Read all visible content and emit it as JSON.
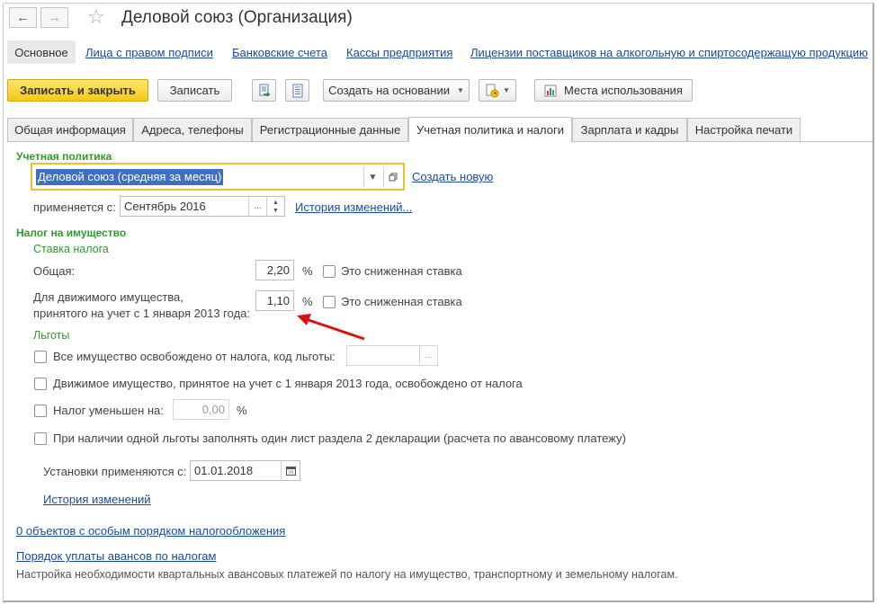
{
  "window": {
    "title": "Деловой союз (Организация)"
  },
  "nav_links": {
    "main": "Основное",
    "items": [
      "Лица с правом подписи",
      "Банковские счета",
      "Кассы предприятия",
      "Лицензии поставщиков на алкогольную и спиртосодержащую продукцию"
    ]
  },
  "toolbar": {
    "save_close": "Записать и закрыть",
    "save": "Записать",
    "create_based_on": "Создать на основании",
    "usage_places": "Места использования"
  },
  "tabs": [
    "Общая информация",
    "Адреса, телефоны",
    "Регистрационные данные",
    "Учетная политика и налоги",
    "Зарплата и кадры",
    "Настройка печати"
  ],
  "accounting_policy": {
    "section_title": "Учетная политика",
    "policy_value": "Деловой союз (средняя за месяц)",
    "create_new": "Создать новую",
    "applies_from_label": "применяется с:",
    "applies_from_value": "Сентябрь 2016",
    "history_link": "История изменений..."
  },
  "property_tax": {
    "section_title": "Налог на имущество",
    "rate_title": "Ставка налога",
    "general_label": "Общая:",
    "general_value": "2,20",
    "percent": "%",
    "reduced_label": "Это сниженная ставка",
    "movable_label_1": "Для движимого имущества,",
    "movable_label_2": "принятого на учет с 1 января 2013 года:",
    "movable_value": "1,10",
    "benefits_title": "Льготы",
    "all_exempt": "Все имущество освобождено от налога, код льготы:",
    "movable_exempt": "Движимое имущество, принятое на учет с 1 января 2013 года, освобождено от налога",
    "reduced_by": "Налог уменьшен на:",
    "reduced_by_value": "0,00",
    "one_sheet": "При наличии одной льготы заполнять один лист раздела 2 декларации (расчета по авансовому платежу)",
    "settings_from_label": "Установки применяются с:",
    "settings_from_value": "01.01.2018",
    "history_link": "История изменений"
  },
  "footer": {
    "special_objects": "0 объектов с особым порядком налогообложения",
    "advance_order": "Порядок уплаты авансов по налогам",
    "hint": "Настройка необходимости квартальных авансовых платежей по налогу на имущество, транспортному и земельному налогам."
  },
  "colors": {
    "accent_green": "#2e9a2e",
    "link_blue": "#1a4a9c",
    "primary_yellow": "#f3c816",
    "arrow_red": "#e01010"
  }
}
